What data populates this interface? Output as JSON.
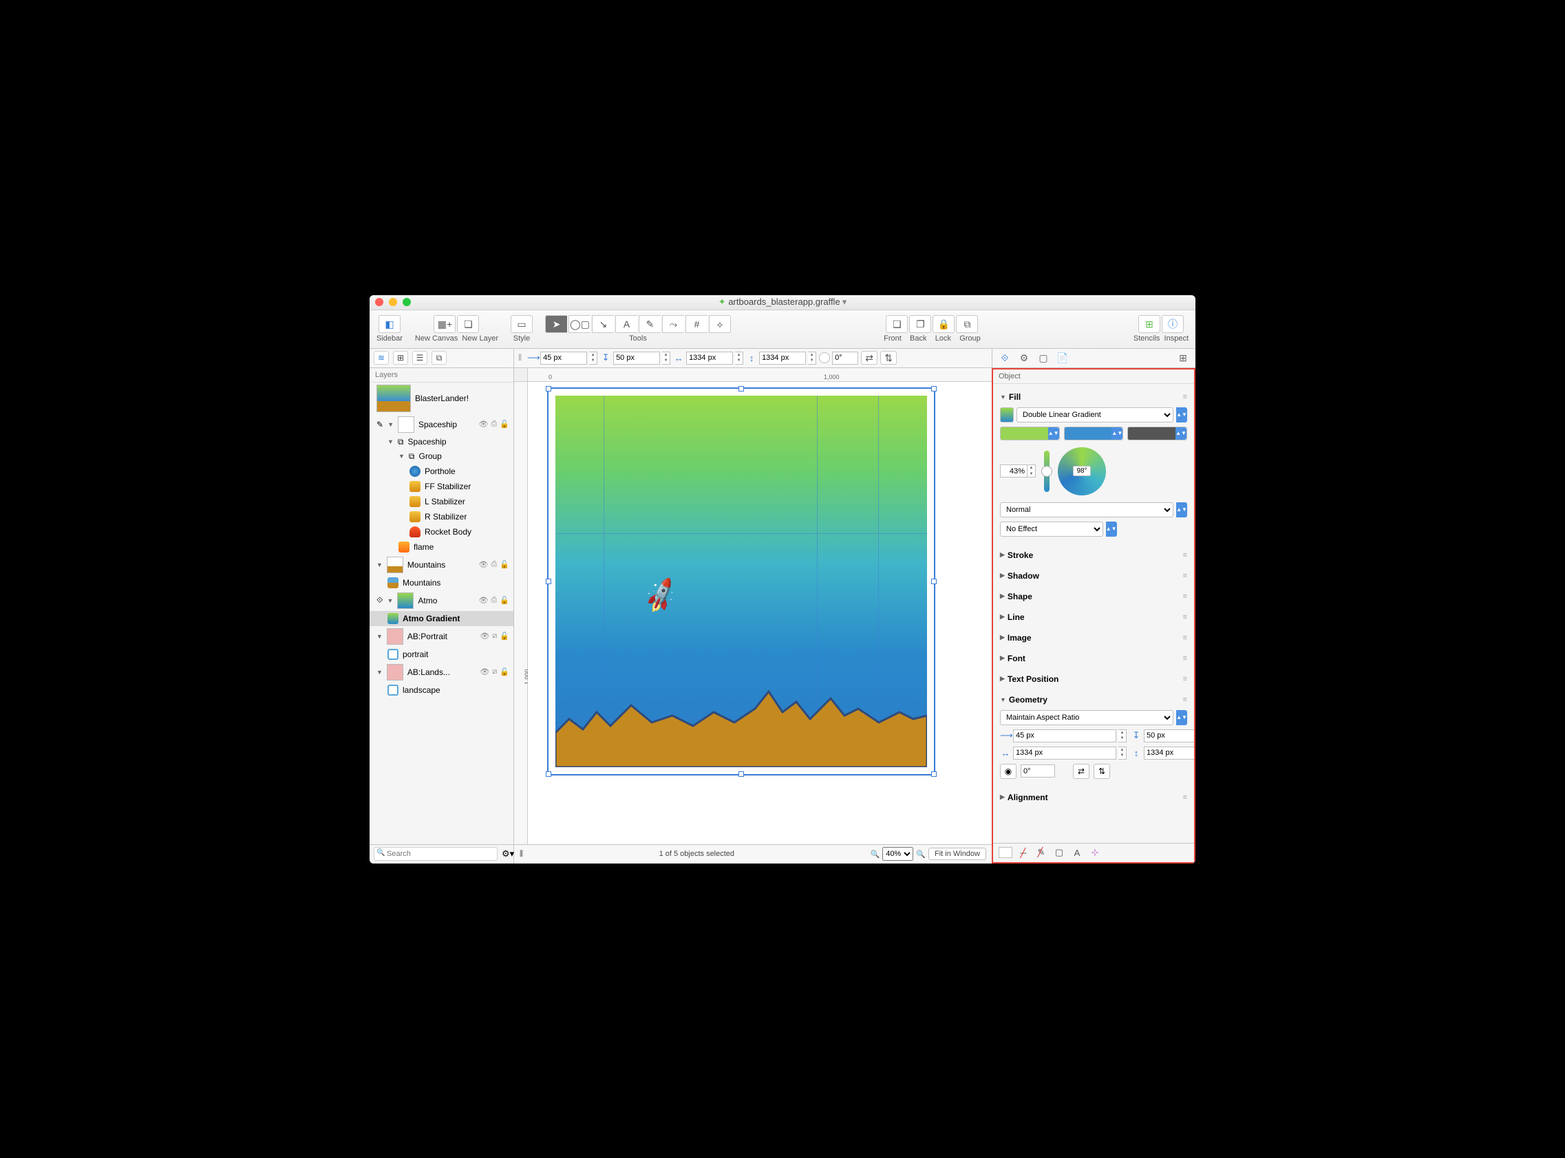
{
  "title": "artboards_blasterapp.graffle",
  "modified_marker": "▾",
  "toolbar": {
    "sidebar": "Sidebar",
    "new_canvas": "New Canvas",
    "new_layer": "New Layer",
    "style": "Style",
    "tools": "Tools",
    "front": "Front",
    "back": "Back",
    "lock": "Lock",
    "group": "Group",
    "stencils": "Stencils",
    "inspect": "Inspect"
  },
  "geom_bar": {
    "x": "45 px",
    "y": "50 px",
    "w": "1334 px",
    "h": "1334 px",
    "rot": "0°"
  },
  "ruler": {
    "zero": "0",
    "thousand": "1,000",
    "v_thousand": "1,000"
  },
  "sidebar": {
    "header": "Layers",
    "canvas_name": "BlasterLander!",
    "layers": {
      "spaceship": "Spaceship",
      "spaceship2": "Spaceship",
      "group": "Group",
      "porthole": "Porthole",
      "ff_stab": "FF Stabilizer",
      "l_stab": "L Stabilizer",
      "r_stab": "R Stabilizer",
      "rocket_body": "Rocket Body",
      "flame": "flame",
      "mountains": "Mountains",
      "mountains2": "Mountains",
      "atmo": "Atmo",
      "atmo_grad": "Atmo Gradient",
      "ab_portrait": "AB:Portrait",
      "portrait": "portrait",
      "ab_landscape": "AB:Lands...",
      "landscape": "landscape"
    },
    "search_ph": "Search"
  },
  "canvas": {
    "selection": "1 of 5 objects selected",
    "zoom": "40%",
    "fit": "Fit in Window"
  },
  "inspector": {
    "header": "Object",
    "sections": {
      "fill": "Fill",
      "stroke": "Stroke",
      "shadow": "Shadow",
      "shape": "Shape",
      "line": "Line",
      "image": "Image",
      "font": "Font",
      "text_position": "Text Position",
      "geometry": "Geometry",
      "alignment": "Alignment"
    },
    "fill": {
      "type": "Double Linear Gradient",
      "colors": [
        "#99d455",
        "#3b8fd1",
        "#555555"
      ],
      "midpoint": "43%",
      "angle": "98°",
      "blend": "Normal",
      "effect": "No Effect"
    },
    "geometry": {
      "aspect": "Maintain Aspect Ratio",
      "x": "45 px",
      "y": "50 px",
      "w": "1334 px",
      "h": "1334 px",
      "rot": "0°"
    }
  }
}
